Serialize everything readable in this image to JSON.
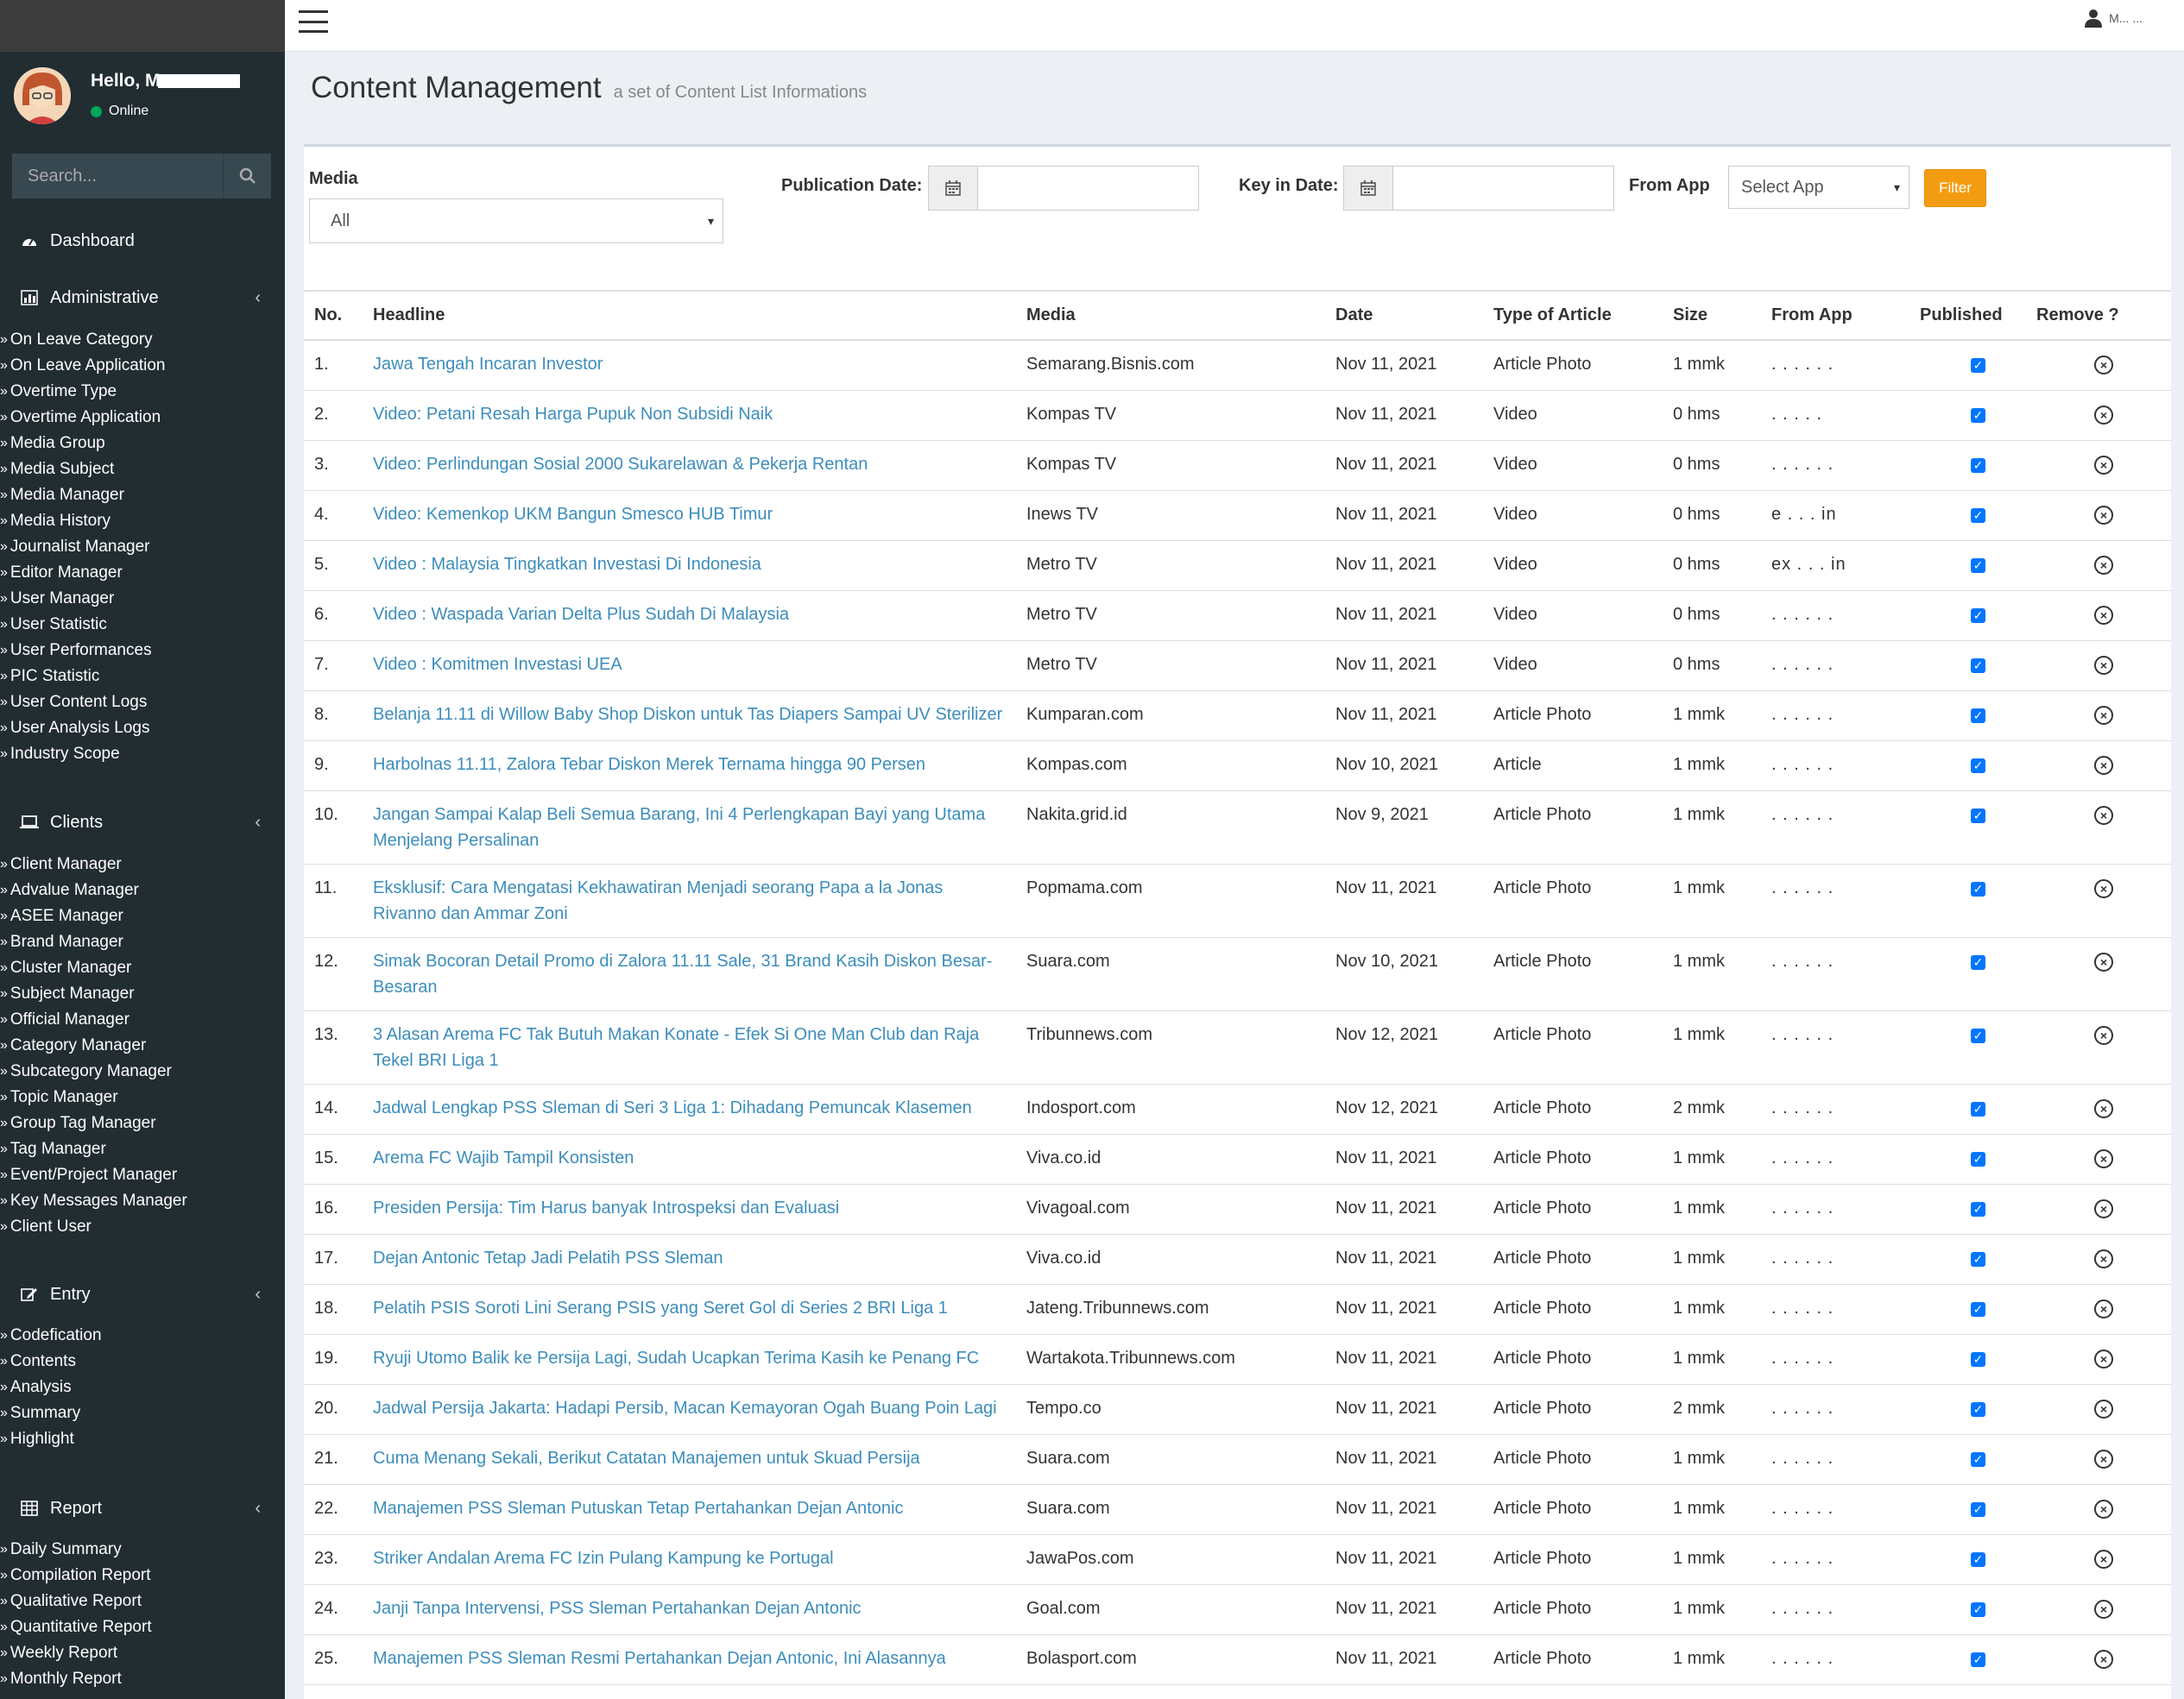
{
  "sidebar": {
    "greeting": "Hello, M",
    "status": "Online",
    "search_placeholder": "Search...",
    "dashboard": "Dashboard",
    "sections": {
      "administrative": {
        "title": "Administrative",
        "items": [
          "On Leave Category",
          "On Leave Application",
          "Overtime Type",
          "Overtime Application",
          "Media Group",
          "Media Subject",
          "Media Manager",
          "Media History",
          "Journalist Manager",
          "Editor Manager",
          "User Manager",
          "User Statistic",
          "User Performances",
          "PIC Statistic",
          "User Content Logs",
          "User Analysis Logs",
          "Industry Scope"
        ]
      },
      "clients": {
        "title": "Clients",
        "items": [
          "Client Manager",
          "Advalue Manager",
          "ASEE Manager",
          "Brand Manager",
          "Cluster Manager",
          "Subject Manager",
          "Official Manager",
          "Category Manager",
          "Subcategory Manager",
          "Topic Manager",
          "Group Tag Manager",
          "Tag Manager",
          "Event/Project Manager",
          "Key Messages Manager",
          "Client User"
        ]
      },
      "entry": {
        "title": "Entry",
        "items": [
          "Codefication",
          "Contents",
          "Analysis",
          "Summary",
          "Highlight"
        ]
      },
      "report": {
        "title": "Report",
        "items": [
          "Daily Summary",
          "Compilation Report",
          "Qualitative Report",
          "Quantitative Report",
          "Weekly Report",
          "Monthly Report"
        ]
      }
    }
  },
  "header": {
    "user_name": "M... ..."
  },
  "page": {
    "title": "Content Management",
    "subtitle": "a set of Content List Informations"
  },
  "filters": {
    "media_label": "Media",
    "media_value": "All",
    "publication_date_label": "Publication Date:",
    "key_in_date_label": "Key in Date:",
    "from_app_label": "From App",
    "from_app_value": "Select App",
    "filter_button": "Filter"
  },
  "table": {
    "columns": [
      "No.",
      "Headline",
      "Media",
      "Date",
      "Type of Article",
      "Size",
      "From App",
      "Published",
      "Remove ?"
    ],
    "rows": [
      {
        "no": "1.",
        "headline": "Jawa Tengah Incaran Investor",
        "media": "Semarang.Bisnis.com",
        "date": "Nov 11, 2021",
        "type": "Article Photo",
        "size": "1 mmk",
        "app": ". . . . . .",
        "tall": false
      },
      {
        "no": "2.",
        "headline": "Video: Petani Resah Harga Pupuk Non Subsidi Naik",
        "media": "Kompas TV",
        "date": "Nov 11, 2021",
        "type": "Video",
        "size": "0 hms",
        "app": ". . . . .",
        "tall": false
      },
      {
        "no": "3.",
        "headline": "Video: Perlindungan Sosial 2000 Sukarelawan & Pekerja Rentan",
        "media": "Kompas TV",
        "date": "Nov 11, 2021",
        "type": "Video",
        "size": "0 hms",
        "app": ". . . . . .",
        "tall": false
      },
      {
        "no": "4.",
        "headline": "Video: Kemenkop UKM Bangun Smesco HUB Timur",
        "media": "Inews TV",
        "date": "Nov 11, 2021",
        "type": "Video",
        "size": "0 hms",
        "app": "e . . . in",
        "tall": false
      },
      {
        "no": "5.",
        "headline": "Video : Malaysia Tingkatkan Investasi Di Indonesia",
        "media": "Metro TV",
        "date": "Nov 11, 2021",
        "type": "Video",
        "size": "0 hms",
        "app": "ex . . . in",
        "tall": false
      },
      {
        "no": "6.",
        "headline": "Video : Waspada Varian Delta Plus Sudah Di Malaysia",
        "media": "Metro TV",
        "date": "Nov 11, 2021",
        "type": "Video",
        "size": "0 hms",
        "app": ". . . . . .",
        "tall": false
      },
      {
        "no": "7.",
        "headline": "Video : Komitmen Investasi UEA",
        "media": "Metro TV",
        "date": "Nov 11, 2021",
        "type": "Video",
        "size": "0 hms",
        "app": ". . . . . .",
        "tall": false
      },
      {
        "no": "8.",
        "headline": "Belanja 11.11 di Willow Baby Shop Diskon untuk Tas Diapers Sampai UV Sterilizer",
        "media": "Kumparan.com",
        "date": "Nov 11, 2021",
        "type": "Article Photo",
        "size": "1 mmk",
        "app": ". . . . . .",
        "tall": false
      },
      {
        "no": "9.",
        "headline": "Harbolnas 11.11, Zalora Tebar Diskon Merek Ternama hingga 90 Persen",
        "media": "Kompas.com",
        "date": "Nov 10, 2021",
        "type": "Article",
        "size": "1 mmk",
        "app": ". . . . . .",
        "tall": false
      },
      {
        "no": "10.",
        "headline": "Jangan Sampai Kalap Beli Semua Barang, Ini 4 Perlengkapan Bayi yang Utama Menjelang Persalinan",
        "media": "Nakita.grid.id",
        "date": "Nov 9, 2021",
        "type": "Article Photo",
        "size": "1 mmk",
        "app": ". . . . . .",
        "tall": true
      },
      {
        "no": "11.",
        "headline": "Eksklusif: Cara Mengatasi Kekhawatiran Menjadi seorang Papa a la Jonas Rivanno dan Ammar Zoni",
        "media": "Popmama.com",
        "date": "Nov 11, 2021",
        "type": "Article Photo",
        "size": "1 mmk",
        "app": ". . . . . .",
        "tall": true
      },
      {
        "no": "12.",
        "headline": "Simak Bocoran Detail Promo di Zalora 11.11 Sale, 31 Brand Kasih Diskon Besar-Besaran",
        "media": "Suara.com",
        "date": "Nov 10, 2021",
        "type": "Article Photo",
        "size": "1 mmk",
        "app": ". . . . . .",
        "tall": true
      },
      {
        "no": "13.",
        "headline": "3 Alasan Arema FC Tak Butuh Makan Konate - Efek Si One Man Club dan Raja Tekel BRI Liga 1",
        "media": "Tribunnews.com",
        "date": "Nov 12, 2021",
        "type": "Article Photo",
        "size": "1 mmk",
        "app": ". . . . . .",
        "tall": true
      },
      {
        "no": "14.",
        "headline": "Jadwal Lengkap PSS Sleman di Seri 3 Liga 1: Dihadang Pemuncak Klasemen",
        "media": "Indosport.com",
        "date": "Nov 12, 2021",
        "type": "Article Photo",
        "size": "2 mmk",
        "app": ". . . . . .",
        "tall": false
      },
      {
        "no": "15.",
        "headline": "Arema FC Wajib Tampil Konsisten",
        "media": "Viva.co.id",
        "date": "Nov 11, 2021",
        "type": "Article Photo",
        "size": "1 mmk",
        "app": ". . . . . .",
        "tall": false
      },
      {
        "no": "16.",
        "headline": "Presiden Persija: Tim Harus banyak Introspeksi dan Evaluasi",
        "media": "Vivagoal.com",
        "date": "Nov 11, 2021",
        "type": "Article Photo",
        "size": "1 mmk",
        "app": ". . . . . .",
        "tall": false
      },
      {
        "no": "17.",
        "headline": "Dejan Antonic Tetap Jadi Pelatih PSS Sleman",
        "media": "Viva.co.id",
        "date": "Nov 11, 2021",
        "type": "Article Photo",
        "size": "1 mmk",
        "app": ". . . . . .",
        "tall": false
      },
      {
        "no": "18.",
        "headline": "Pelatih PSIS Soroti Lini Serang PSIS yang Seret Gol di Series 2 BRI Liga 1",
        "media": "Jateng.Tribunnews.com",
        "date": "Nov 11, 2021",
        "type": "Article Photo",
        "size": "1 mmk",
        "app": ". . . . . .",
        "tall": false
      },
      {
        "no": "19.",
        "headline": "Ryuji Utomo Balik ke Persija Lagi, Sudah Ucapkan Terima Kasih ke Penang FC",
        "media": "Wartakota.Tribunnews.com",
        "date": "Nov 11, 2021",
        "type": "Article Photo",
        "size": "1 mmk",
        "app": ". . . . . .",
        "tall": false
      },
      {
        "no": "20.",
        "headline": "Jadwal Persija Jakarta: Hadapi Persib, Macan Kemayoran Ogah Buang Poin Lagi",
        "media": "Tempo.co",
        "date": "Nov 11, 2021",
        "type": "Article Photo",
        "size": "2 mmk",
        "app": ". . . . . .",
        "tall": false
      },
      {
        "no": "21.",
        "headline": "Cuma Menang Sekali, Berikut Catatan Manajemen untuk Skuad Persija",
        "media": "Suara.com",
        "date": "Nov 11, 2021",
        "type": "Article Photo",
        "size": "1 mmk",
        "app": ". . . . . .",
        "tall": false
      },
      {
        "no": "22.",
        "headline": "Manajemen PSS Sleman Putuskan Tetap Pertahankan Dejan Antonic",
        "media": "Suara.com",
        "date": "Nov 11, 2021",
        "type": "Article Photo",
        "size": "1 mmk",
        "app": ". . . . . .",
        "tall": false
      },
      {
        "no": "23.",
        "headline": "Striker Andalan Arema FC Izin Pulang Kampung ke Portugal",
        "media": "JawaPos.com",
        "date": "Nov 11, 2021",
        "type": "Article Photo",
        "size": "1 mmk",
        "app": ". . . . . .",
        "tall": false
      },
      {
        "no": "24.",
        "headline": "Janji Tanpa Intervensi, PSS Sleman Pertahankan Dejan Antonic",
        "media": "Goal.com",
        "date": "Nov 11, 2021",
        "type": "Article Photo",
        "size": "1 mmk",
        "app": ". . . . . .",
        "tall": false
      },
      {
        "no": "25.",
        "headline": "Manajemen PSS Sleman Resmi Pertahankan Dejan Antonic, Ini Alasannya",
        "media": "Bolasport.com",
        "date": "Nov 11, 2021",
        "type": "Article Photo",
        "size": "1 mmk",
        "app": ". . . . . .",
        "tall": false
      }
    ]
  },
  "icons": {
    "published": "checkbox-checked-icon",
    "remove": "remove-circle-icon"
  },
  "colors": {
    "sidebar_bg": "#222d32",
    "link": "#3c8dbc",
    "filter_button": "#f39c12",
    "online": "#00a65a"
  }
}
